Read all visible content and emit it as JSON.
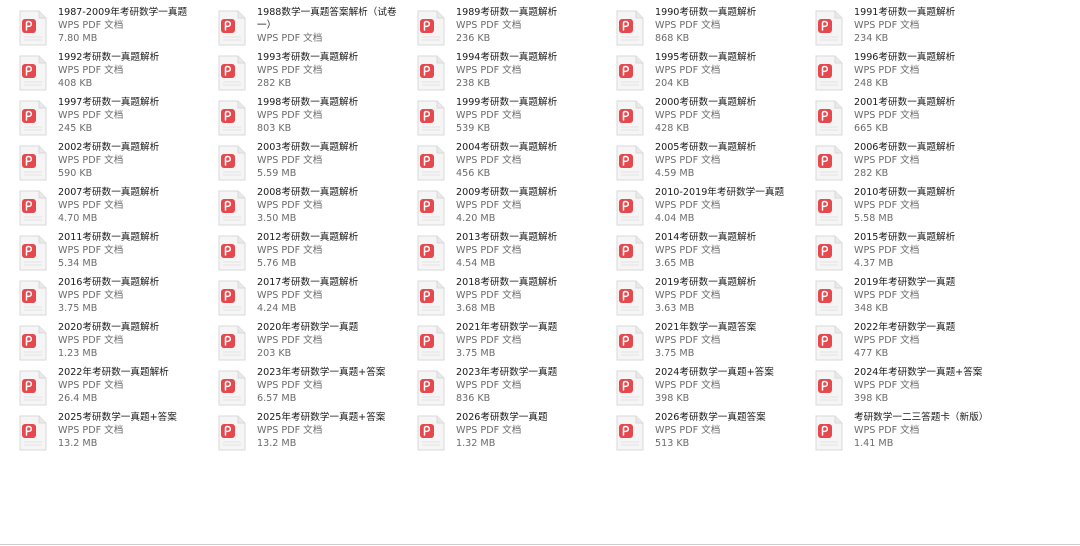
{
  "files": [
    {
      "name": "1987-2009年考研数学一真题",
      "type": "WPS PDF 文档",
      "size": "7.80 MB"
    },
    {
      "name": "1988数学一真题答案解析（试卷一）",
      "type": "WPS PDF 文档",
      "size": ""
    },
    {
      "name": "1989考研数一真题解析",
      "type": "WPS PDF 文档",
      "size": "236 KB"
    },
    {
      "name": "1990考研数一真题解析",
      "type": "WPS PDF 文档",
      "size": "868 KB"
    },
    {
      "name": "1991考研数一真题解析",
      "type": "WPS PDF 文档",
      "size": "234 KB"
    },
    {
      "name": "1992考研数一真题解析",
      "type": "WPS PDF 文档",
      "size": "408 KB"
    },
    {
      "name": "1993考研数一真题解析",
      "type": "WPS PDF 文档",
      "size": "282 KB"
    },
    {
      "name": "1994考研数一真题解析",
      "type": "WPS PDF 文档",
      "size": "238 KB"
    },
    {
      "name": "1995考研数一真题解析",
      "type": "WPS PDF 文档",
      "size": "204 KB"
    },
    {
      "name": "1996考研数一真题解析",
      "type": "WPS PDF 文档",
      "size": "248 KB"
    },
    {
      "name": "1997考研数一真题解析",
      "type": "WPS PDF 文档",
      "size": "245 KB"
    },
    {
      "name": "1998考研数一真题解析",
      "type": "WPS PDF 文档",
      "size": "803 KB"
    },
    {
      "name": "1999考研数一真题解析",
      "type": "WPS PDF 文档",
      "size": "539 KB"
    },
    {
      "name": "2000考研数一真题解析",
      "type": "WPS PDF 文档",
      "size": "428 KB"
    },
    {
      "name": "2001考研数一真题解析",
      "type": "WPS PDF 文档",
      "size": "665 KB"
    },
    {
      "name": "2002考研数一真题解析",
      "type": "WPS PDF 文档",
      "size": "590 KB"
    },
    {
      "name": "2003考研数一真题解析",
      "type": "WPS PDF 文档",
      "size": "5.59 MB"
    },
    {
      "name": "2004考研数一真题解析",
      "type": "WPS PDF 文档",
      "size": "456 KB"
    },
    {
      "name": "2005考研数一真题解析",
      "type": "WPS PDF 文档",
      "size": "4.59 MB"
    },
    {
      "name": "2006考研数一真题解析",
      "type": "WPS PDF 文档",
      "size": "282 KB"
    },
    {
      "name": "2007考研数一真题解析",
      "type": "WPS PDF 文档",
      "size": "4.70 MB"
    },
    {
      "name": "2008考研数一真题解析",
      "type": "WPS PDF 文档",
      "size": "3.50 MB"
    },
    {
      "name": "2009考研数一真题解析",
      "type": "WPS PDF 文档",
      "size": "4.20 MB"
    },
    {
      "name": "2010-2019年考研数学一真题",
      "type": "WPS PDF 文档",
      "size": "4.04 MB"
    },
    {
      "name": "2010考研数一真题解析",
      "type": "WPS PDF 文档",
      "size": "5.58 MB"
    },
    {
      "name": "2011考研数一真题解析",
      "type": "WPS PDF 文档",
      "size": "5.34 MB"
    },
    {
      "name": "2012考研数一真题解析",
      "type": "WPS PDF 文档",
      "size": "5.76 MB"
    },
    {
      "name": "2013考研数一真题解析",
      "type": "WPS PDF 文档",
      "size": "4.54 MB"
    },
    {
      "name": "2014考研数一真题解析",
      "type": "WPS PDF 文档",
      "size": "3.65 MB"
    },
    {
      "name": "2015考研数一真题解析",
      "type": "WPS PDF 文档",
      "size": "4.37 MB"
    },
    {
      "name": "2016考研数一真题解析",
      "type": "WPS PDF 文档",
      "size": "3.75 MB"
    },
    {
      "name": "2017考研数一真题解析",
      "type": "WPS PDF 文档",
      "size": "4.24 MB"
    },
    {
      "name": "2018考研数一真题解析",
      "type": "WPS PDF 文档",
      "size": "3.68 MB"
    },
    {
      "name": "2019考研数一真题解析",
      "type": "WPS PDF 文档",
      "size": "3.63 MB"
    },
    {
      "name": "2019年考研数学一真题",
      "type": "WPS PDF 文档",
      "size": "348 KB"
    },
    {
      "name": "2020考研数一真题解析",
      "type": "WPS PDF 文档",
      "size": "1.23 MB"
    },
    {
      "name": "2020年考研数学一真题",
      "type": "WPS PDF 文档",
      "size": "203 KB"
    },
    {
      "name": "2021年考研数学一真题",
      "type": "WPS PDF 文档",
      "size": "3.75 MB"
    },
    {
      "name": "2021年数学一真题答案",
      "type": "WPS PDF 文档",
      "size": "3.75 MB"
    },
    {
      "name": "2022年考研数学一真题",
      "type": "WPS PDF 文档",
      "size": "477 KB"
    },
    {
      "name": "2022年考研数一真题解析",
      "type": "WPS PDF 文档",
      "size": "26.4 MB"
    },
    {
      "name": "2023年考研数学一真题+答案",
      "type": "WPS PDF 文档",
      "size": "6.57 MB"
    },
    {
      "name": "2023年考研数学一真题",
      "type": "WPS PDF 文档",
      "size": "836 KB"
    },
    {
      "name": "2024考研数学一真题+答案",
      "type": "WPS PDF 文档",
      "size": "398 KB"
    },
    {
      "name": "2024年考研数学一真题+答案",
      "type": "WPS PDF 文档",
      "size": "398 KB"
    },
    {
      "name": "2025考研数学一真题+答案",
      "type": "WPS PDF 文档",
      "size": "13.2 MB"
    },
    {
      "name": "2025年考研数学一真题+答案",
      "type": "WPS PDF 文档",
      "size": "13.2 MB"
    },
    {
      "name": "2026考研数学一真题",
      "type": "WPS PDF 文档",
      "size": "1.32 MB"
    },
    {
      "name": "2026考研数学一真题答案",
      "type": "WPS PDF 文档",
      "size": "513 KB"
    },
    {
      "name": "考研数学一二三答题卡（新版）",
      "type": "WPS PDF 文档",
      "size": "1.41 MB"
    }
  ],
  "colors": {
    "icon_red": "#e5484d",
    "page_fill": "#f5f5f5",
    "page_stroke": "#d9d9d9",
    "name_text": "#1a1a1a",
    "meta_text": "#6b6b6b"
  },
  "icon": "wps-pdf-file-icon"
}
